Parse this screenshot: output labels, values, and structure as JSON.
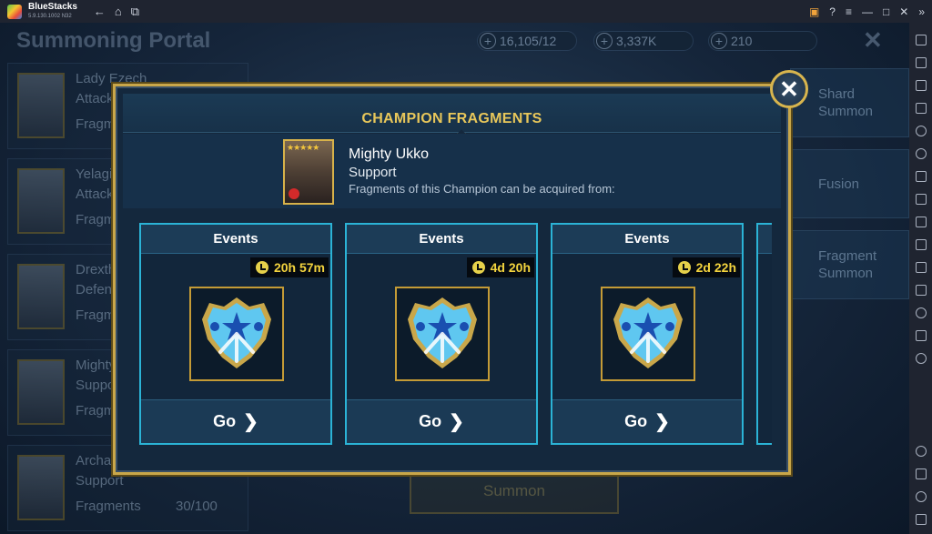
{
  "app": {
    "name": "BlueStacks",
    "version": "5.9.130.1002  N32"
  },
  "background": {
    "title": "Summoning Portal",
    "currencies": [
      "16,105/12",
      "3,337K",
      "210"
    ],
    "champions": [
      {
        "name": "Lady Ezech",
        "role": "Attack",
        "fragments_label": "Fragm"
      },
      {
        "name": "Yelagin",
        "role": "Attack",
        "fragments_label": "Fragm"
      },
      {
        "name": "Drexthar",
        "role": "Defense",
        "fragments_label": "Fragm"
      },
      {
        "name": "Mighty",
        "role": "Support",
        "fragments_label": "Fragm"
      },
      {
        "name": "Archa",
        "role": "Support",
        "fragments_label": "Fragments",
        "progress": "30/100"
      }
    ],
    "menu": [
      {
        "line1": "Shard",
        "line2": "Summon"
      },
      {
        "line1": "Fusion",
        "line2": ""
      },
      {
        "line1": "Fragment",
        "line2": "Summon"
      }
    ],
    "summon_button": "Summon"
  },
  "modal": {
    "title": "CHAMPION FRAGMENTS",
    "champion": {
      "name": "Mighty Ukko",
      "role": "Support",
      "source_text": "Fragments of this Champion can be acquired from:",
      "stars": "★★★★★"
    },
    "sources": [
      {
        "type": "Events",
        "timer": "20h 57m",
        "action": "Go"
      },
      {
        "type": "Events",
        "timer": "4d 20h",
        "action": "Go"
      },
      {
        "type": "Events",
        "timer": "2d 22h",
        "action": "Go"
      }
    ],
    "colors": {
      "gold": "#c9a74a",
      "accent": "#2bb3d6",
      "timer": "#f4d43e"
    }
  }
}
